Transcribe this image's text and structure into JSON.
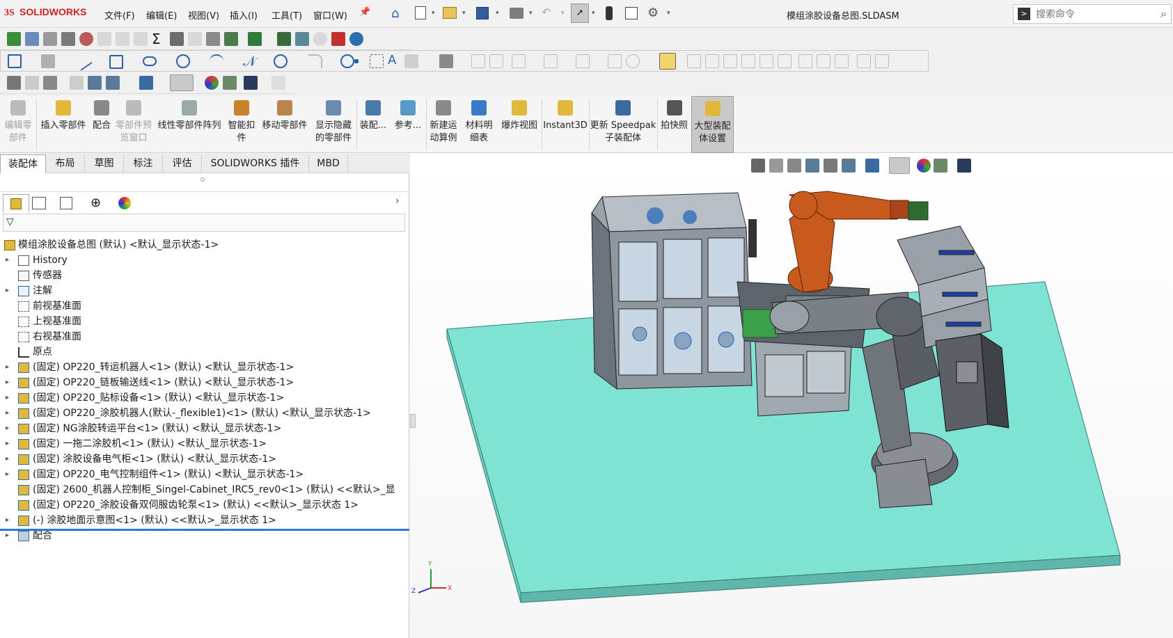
{
  "titlebar": {
    "app_name": "SOLIDWORKS",
    "menus": [
      "文件(F)",
      "编辑(E)",
      "视图(V)",
      "插入(I)",
      "工具(T)",
      "窗口(W)"
    ],
    "doc_title": "模组涂胶设备总图.SLDASM",
    "search_placeholder": "搜索命令"
  },
  "ribbon": {
    "buttons": [
      {
        "label": "编辑零\n部件",
        "disabled": true
      },
      {
        "label": "插入零部件",
        "disabled": false
      },
      {
        "label": "配合",
        "disabled": false
      },
      {
        "label": "零部件预\n览窗口",
        "disabled": true
      },
      {
        "label": "线性零部件阵列",
        "disabled": false
      },
      {
        "label": "智能扣\n件",
        "disabled": false
      },
      {
        "label": "移动零部件",
        "disabled": false
      },
      {
        "label": "显示隐藏\n的零部件",
        "disabled": false
      },
      {
        "label": "装配...",
        "disabled": false
      },
      {
        "label": "参考...",
        "disabled": false
      },
      {
        "label": "新建运\n动算例",
        "disabled": false
      },
      {
        "label": "材料明\n细表",
        "disabled": false
      },
      {
        "label": "爆炸视图",
        "disabled": false
      },
      {
        "label": "Instant3D",
        "disabled": false
      },
      {
        "label": "更新 Speedpak\n子装配体",
        "disabled": false
      },
      {
        "label": "拍快照",
        "disabled": false
      },
      {
        "label": "大型装配\n体设置",
        "disabled": false,
        "active": true
      }
    ]
  },
  "tabs": [
    "装配体",
    "布局",
    "草图",
    "标注",
    "评估",
    "SOLIDWORKS 插件",
    "MBD"
  ],
  "tree": {
    "root": "模组涂胶设备总图 (默认) <默认_显示状态-1>",
    "items": [
      {
        "label": "History",
        "icon": "history-icon",
        "expandable": true
      },
      {
        "label": "传感器",
        "icon": "sensor-icon",
        "expandable": false
      },
      {
        "label": "注解",
        "icon": "annotation-icon",
        "expandable": true
      },
      {
        "label": "前视基准面",
        "icon": "plane-icon",
        "expandable": false
      },
      {
        "label": "上视基准面",
        "icon": "plane-icon",
        "expandable": false
      },
      {
        "label": "右视基准面",
        "icon": "plane-icon",
        "expandable": false
      },
      {
        "label": "原点",
        "icon": "origin-icon",
        "expandable": false
      },
      {
        "label": "(固定) OP220_转运机器人<1> (默认) <默认_显示状态-1>",
        "icon": "assembly-icon",
        "expandable": true
      },
      {
        "label": "(固定) OP220_链板输送线<1> (默认) <默认_显示状态-1>",
        "icon": "assembly-icon",
        "expandable": true
      },
      {
        "label": "(固定) OP220_贴标设备<1> (默认) <默认_显示状态-1>",
        "icon": "assembly-icon",
        "expandable": true
      },
      {
        "label": "(固定) OP220_涂胶机器人(默认-_flexible1)<1> (默认) <默认_显示状态-1>",
        "icon": "assembly-icon",
        "expandable": true
      },
      {
        "label": "(固定) NG涂胶转运平台<1> (默认) <默认_显示状态-1>",
        "icon": "assembly-icon",
        "expandable": true
      },
      {
        "label": "(固定) 一拖二涂胶机<1> (默认) <默认_显示状态-1>",
        "icon": "assembly-icon",
        "expandable": true
      },
      {
        "label": "(固定) 涂胶设备电气柜<1> (默认) <默认_显示状态-1>",
        "icon": "assembly-icon",
        "expandable": true
      },
      {
        "label": "(固定) OP220_电气控制组件<1> (默认) <默认_显示状态-1>",
        "icon": "assembly-icon",
        "expandable": true
      },
      {
        "label": "(固定) 2600_机器人控制柜_Singel-Cabinet_IRC5_rev0<1> (默认) <<默认>_显",
        "icon": "assembly-icon",
        "expandable": false
      },
      {
        "label": "(固定) OP220_涂胶设备双伺服齿轮泵<1> (默认) <<默认>_显示状态 1>",
        "icon": "assembly-icon",
        "expandable": false
      },
      {
        "label": "(-) 涂胶地面示意图<1> (默认) <<默认>_显示状态 1>",
        "icon": "assembly-icon",
        "expandable": true
      },
      {
        "label": "配合",
        "icon": "mates-icon",
        "expandable": true
      }
    ]
  },
  "triad": {
    "x": "X",
    "y": "Y",
    "z": "Z"
  },
  "colors": {
    "floor": "#7fe3d4",
    "robot": "#c85a1e",
    "accent": "#1c63b6",
    "cabinet": "#8a9098"
  }
}
